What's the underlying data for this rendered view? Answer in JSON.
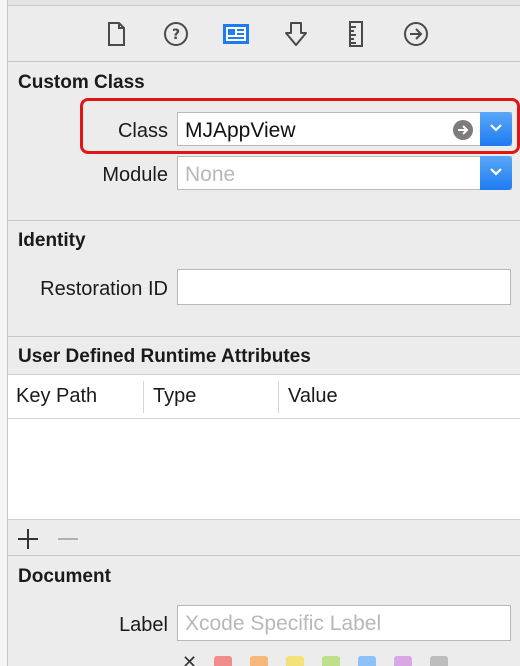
{
  "toolbar": {
    "icons": [
      "file-inspector-icon",
      "quick-help-icon",
      "identity-inspector-icon",
      "attributes-inspector-icon",
      "size-inspector-icon",
      "connections-inspector-icon"
    ]
  },
  "custom_class": {
    "title": "Custom Class",
    "class_label": "Class",
    "class_value": "MJAppView",
    "module_label": "Module",
    "module_placeholder": "None"
  },
  "identity": {
    "title": "Identity",
    "restoration_label": "Restoration ID",
    "restoration_value": ""
  },
  "runtime_attributes": {
    "title": "User Defined Runtime Attributes",
    "columns": [
      "Key Path",
      "Type",
      "Value"
    ],
    "add_label": "+",
    "remove_label": "−"
  },
  "document": {
    "title": "Document",
    "label_label": "Label",
    "label_placeholder": "Xcode Specific Label",
    "clear_label": "✕"
  },
  "colors": {
    "accent": "#1e7bf2",
    "highlight": "#e01616",
    "label_swatches": [
      "#f28b8b",
      "#f5b77a",
      "#f3e27a",
      "#bfe08a",
      "#8ec1f5",
      "#d9a6e6",
      "#bdbdbd"
    ]
  }
}
